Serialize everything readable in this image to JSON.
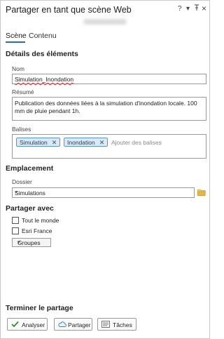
{
  "pane": {
    "title": "Partager en tant que scène Web",
    "controls": {
      "help": "?",
      "menu": "▾",
      "pin": "⊥",
      "close": "×"
    }
  },
  "tabs": [
    {
      "label": "Scène",
      "active": true
    },
    {
      "label": "Contenu",
      "active": false
    }
  ],
  "item_details": {
    "section_title": "Détails des éléments",
    "name_label": "Nom",
    "name_value": "Simulation_Inondation",
    "summary_label": "Résumé",
    "summary_value": "Publication des données liées à la simulation d'inondation locale. 100 mm de pluie pendant 1h.",
    "tags_label": "Balises",
    "tags": [
      "Simulation",
      "Inondation"
    ],
    "tags_placeholder": "Ajouter des balises"
  },
  "location": {
    "section_title": "Emplacement",
    "folder_label": "Dossier",
    "folder_value": "Simulations"
  },
  "share_with": {
    "section_title": "Partager avec",
    "options": [
      {
        "label": "Tout le monde",
        "checked": false
      },
      {
        "label": "Esri France",
        "checked": false
      }
    ],
    "groups_label": "Groupes"
  },
  "finish": {
    "section_title": "Terminer le partage",
    "analyze_label": "Analyser",
    "share_label": "Partager",
    "tasks_label": "Tâches"
  },
  "colors": {
    "accent": "#2b6cb0",
    "tag_bg": "#dbe9f6",
    "tag_border": "#5a95c9",
    "check_green": "#2e8b2e",
    "folder_yellow": "#e8b64a"
  }
}
